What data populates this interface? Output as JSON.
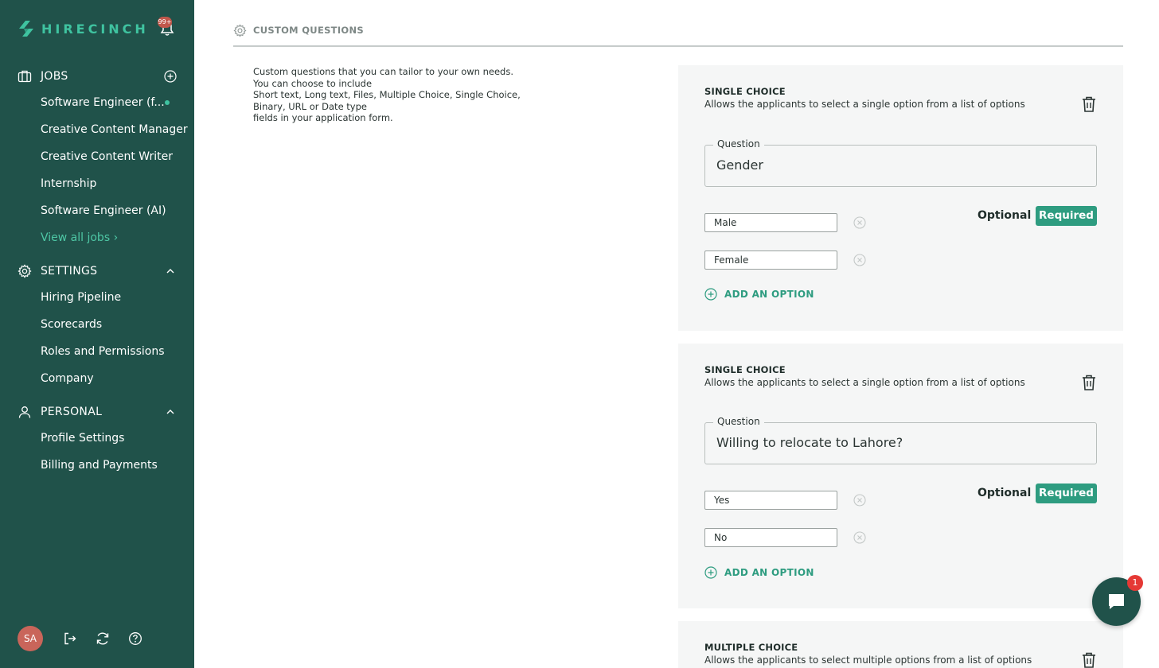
{
  "brand": {
    "name": "HIRECINCH",
    "accent": "#3fc3a0",
    "sidebar_bg": "#20524a"
  },
  "notifications": {
    "count": "99+"
  },
  "sidebar": {
    "jobs": {
      "label": "JOBS",
      "items": [
        {
          "label": "Software Engineer (f..."
        },
        {
          "label": "Creative Content Manager"
        },
        {
          "label": "Creative Content Writer"
        },
        {
          "label": "Internship"
        },
        {
          "label": "Software Engineer (AI)"
        }
      ],
      "view_all": "View all jobs ›"
    },
    "settings": {
      "label": "SETTINGS",
      "items": [
        {
          "label": "Hiring Pipeline"
        },
        {
          "label": "Scorecards"
        },
        {
          "label": "Roles and Permissions"
        },
        {
          "label": "Company"
        }
      ]
    },
    "personal": {
      "label": "PERSONAL",
      "items": [
        {
          "label": "Profile Settings"
        },
        {
          "label": "Billing and Payments"
        }
      ]
    },
    "user": {
      "initials": "SA"
    }
  },
  "main": {
    "section_title": "CUSTOM QUESTIONS",
    "description": [
      "Custom questions that you can tailor to your own needs.",
      "You can choose to include",
      "Short text, Long text, Files, Multiple Choice, Single Choice,",
      "Binary, URL or Date type",
      "fields in your application form."
    ],
    "cards": [
      {
        "type": "SINGLE CHOICE",
        "subtitle": "Allows the applicants to select a single option from a list of options",
        "question_label": "Question",
        "question_value": "Gender",
        "options": [
          "Male",
          "Female"
        ],
        "optional_label": "Optional",
        "required_label": "Required",
        "add_option_label": "ADD AN OPTION"
      },
      {
        "type": "SINGLE CHOICE",
        "subtitle": "Allows the applicants to select a single option from a list of options",
        "question_label": "Question",
        "question_value": "Willing to relocate to Lahore?",
        "options": [
          "Yes",
          "No"
        ],
        "optional_label": "Optional",
        "required_label": "Required",
        "add_option_label": "ADD AN OPTION"
      },
      {
        "type": "MULTIPLE CHOICE",
        "subtitle": "Allows the applicants to select multiple options from a list of options"
      }
    ]
  },
  "chat": {
    "badge": "1"
  },
  "icons": {
    "jobs": "briefcase-icon",
    "settings": "gear-icon",
    "personal": "user-icon",
    "delete": "trash-icon",
    "remove_option": "close-circle-icon",
    "add": "plus-circle-icon",
    "chat": "chat-bubble-icon",
    "logout": "logout-icon",
    "refresh": "refresh-icon",
    "help": "help-icon",
    "notifications": "bell-icon"
  }
}
